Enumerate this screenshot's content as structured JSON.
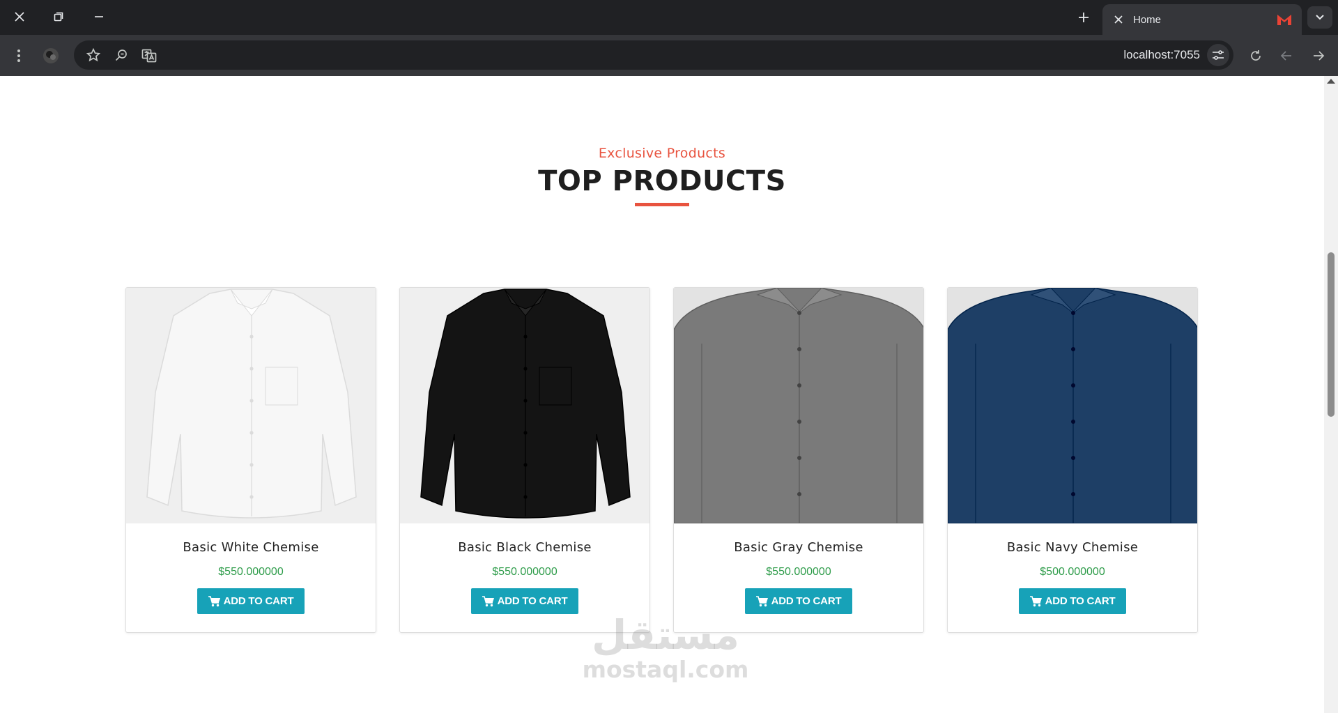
{
  "browser": {
    "tab_title": "Home",
    "url": "localhost:7055",
    "favicon_color": "#ea4335"
  },
  "section": {
    "subtitle": "Exclusive Products",
    "title": "TOP PRODUCTS",
    "accent_color": "#e8533f"
  },
  "products": [
    {
      "name": "Basic White Chemise",
      "price": "$550.000000",
      "button_label": "ADD TO CART",
      "shirt_color": "#f7f7f7",
      "image_bg": "#efefef"
    },
    {
      "name": "Basic Black Chemise",
      "price": "$550.000000",
      "button_label": "ADD TO CART",
      "shirt_color": "#141414",
      "image_bg": "#efefef"
    },
    {
      "name": "Basic Gray Chemise",
      "price": "$550.000000",
      "button_label": "ADD TO CART",
      "shirt_color": "#7a7a7a",
      "image_bg": "#e3e3e3"
    },
    {
      "name": "Basic Navy Chemise",
      "price": "$500.000000",
      "button_label": "ADD TO CART",
      "shirt_color": "#1e3f66",
      "image_bg": "#e3e3e3"
    }
  ],
  "colors": {
    "price": "#2e9c4a",
    "button": "#17a2b8"
  },
  "watermark": {
    "arabic": "مستقل",
    "latin": "mostaql.com"
  }
}
